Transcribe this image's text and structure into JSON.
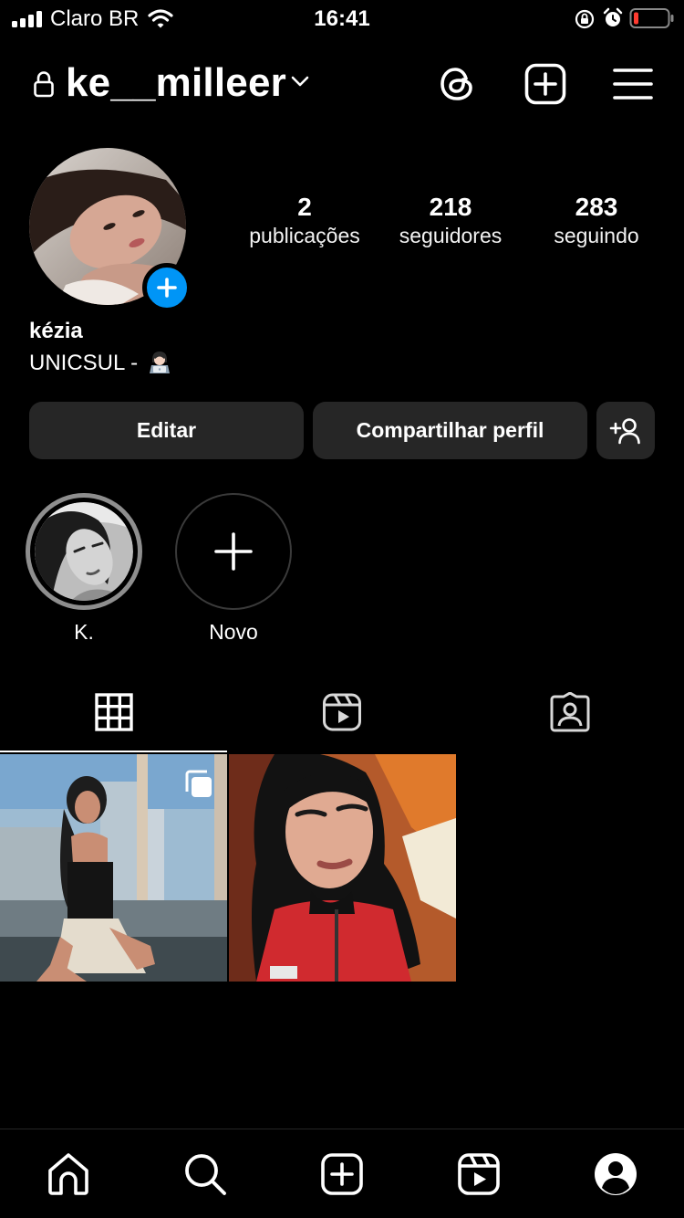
{
  "status_bar": {
    "carrier": "Claro BR",
    "time": "16:41",
    "battery_level": 0.12
  },
  "header": {
    "username": "ke__milleer"
  },
  "profile": {
    "display_name": "kézia",
    "bio": "UNICSUL -",
    "stats": [
      {
        "value": "2",
        "label": "publicações"
      },
      {
        "value": "218",
        "label": "seguidores"
      },
      {
        "value": "283",
        "label": "seguindo"
      }
    ]
  },
  "actions": {
    "edit_label": "Editar",
    "share_label": "Compartilhar perfil"
  },
  "highlights": [
    {
      "label": "K."
    },
    {
      "label": "Novo"
    }
  ],
  "tabs": [
    {
      "icon": "grid-icon",
      "active": true
    },
    {
      "icon": "reels-icon",
      "active": false
    },
    {
      "icon": "tagged-icon",
      "active": false
    }
  ],
  "posts": [
    {
      "type": "carousel"
    },
    {
      "type": "photo"
    }
  ],
  "bottom_nav": [
    "home-icon",
    "search-icon",
    "create-icon",
    "reels-icon",
    "profile-icon"
  ],
  "colors": {
    "background": "#000000",
    "button": "#262626",
    "accent": "#0095f6",
    "battery_low": "#ff3b30"
  }
}
